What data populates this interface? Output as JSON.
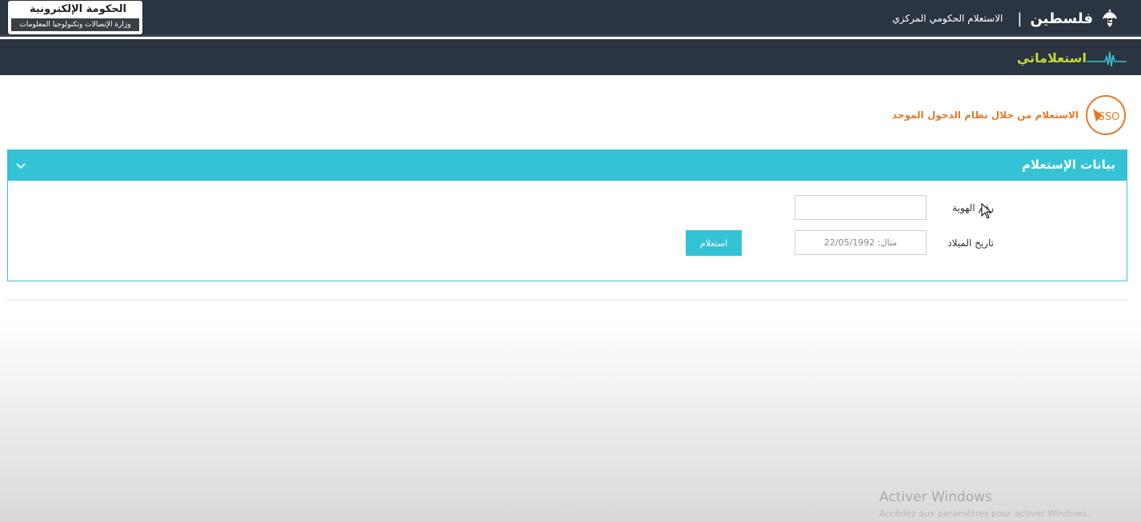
{
  "header": {
    "brand_title": "الحكومة الإلكترونية",
    "brand_subtitle": "وزارة الإتصالات وتكنولوجيا المعلومات",
    "country_name": "فلسطين",
    "separator": "|",
    "service_name": "الاستعلام الحكومي المركزي"
  },
  "app": {
    "logo_text": "استعلاماتي"
  },
  "sso": {
    "icon_text": "SSO",
    "label": "الاستعلام من خلال نظام الدخول الموحد"
  },
  "panel": {
    "title": "بيانات الإستعلام",
    "id_label": "رقم الهوية",
    "id_value": "",
    "dob_label": "تاريخ الميلاد",
    "dob_placeholder": "مثال: 22/05/1992",
    "submit_label": "استعلام"
  },
  "watermark": {
    "title": "Activer Windows",
    "subtitle": "Accédez aux paramètres pour activer Windows."
  },
  "colors": {
    "header_bg": "#2b3441",
    "accent": "#33c3d4",
    "sso_orange": "#e07a2a",
    "logo_green": "#c7d834"
  }
}
